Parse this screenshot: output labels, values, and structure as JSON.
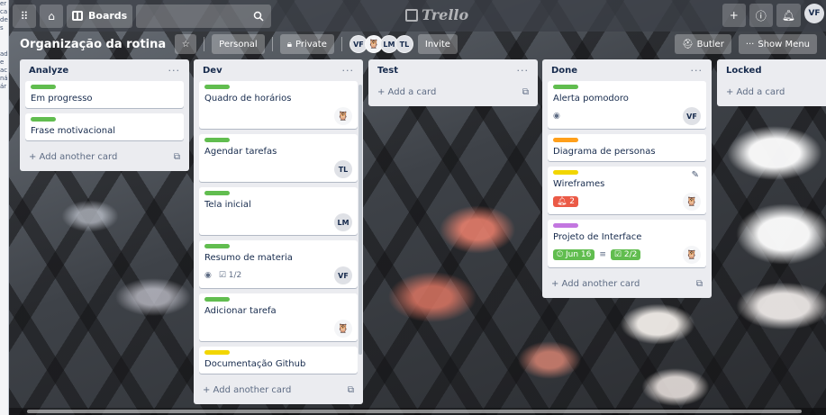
{
  "left_window": {
    "lines": [
      "er slid",
      "ca",
      "de",
      "s",
      "ad",
      "e",
      "ac",
      "ná",
      "ár"
    ]
  },
  "topnav": {
    "apps_icon": "grid-icon",
    "home_icon": "home-icon",
    "boards_label": "Boards",
    "search_icon": "search-icon",
    "logo_text": "Trello",
    "plus_icon": "plus-icon",
    "info_icon": "info-icon",
    "bell_icon": "bell-icon",
    "user_initials": "VF"
  },
  "board": {
    "title": "Organização da rotina",
    "visibility_label": "Personal",
    "privacy_label": "Private",
    "members": [
      "VF",
      "🦉",
      "LM",
      "TL"
    ],
    "invite_label": "Invite",
    "butler_label": "Butler",
    "show_menu_label": "Show Menu"
  },
  "lists": [
    {
      "title": "Analyze",
      "cards": [
        {
          "label_color": "#61bd4f",
          "title": "Em progresso"
        },
        {
          "label_color": "#61bd4f",
          "title": "Frase motivacional"
        }
      ],
      "add_label": "+ Add another card"
    },
    {
      "title": "Dev",
      "cards": [
        {
          "label_color": "#61bd4f",
          "title": "Quadro de horários",
          "member": "🦉"
        },
        {
          "label_color": "#61bd4f",
          "title": "Agendar tarefas",
          "member": "TL"
        },
        {
          "label_color": "#61bd4f",
          "title": "Tela inicial",
          "member": "LM"
        },
        {
          "label_color": "#61bd4f",
          "title": "Resumo de materia",
          "checklist": "1/2",
          "member": "VF"
        },
        {
          "label_color": "#61bd4f",
          "title": "Adicionar tarefa",
          "member": "🦉"
        },
        {
          "label_color": "#f2d600",
          "title": "Documentação Github"
        }
      ],
      "add_label": "+ Add another card"
    },
    {
      "title": "Test",
      "cards": [],
      "add_label": "+ Add a card"
    },
    {
      "title": "Done",
      "cards": [
        {
          "label_color": "#61bd4f",
          "title": "Alerta pomodoro",
          "member": "VF"
        },
        {
          "label_color": "#ff9f1a",
          "title": "Diagrama de personas"
        },
        {
          "label_color": "#f2d600",
          "title": "Wireframes",
          "notifications": "2",
          "member": "🦉"
        },
        {
          "label_color": "#c377e0",
          "title": "Projeto de Interface",
          "due": "Jun 16",
          "checklist": "2/2",
          "member": "🦉"
        }
      ],
      "add_label": "+ Add another card"
    },
    {
      "title": "Locked",
      "cards": [],
      "add_label": "+ Add a card"
    }
  ]
}
